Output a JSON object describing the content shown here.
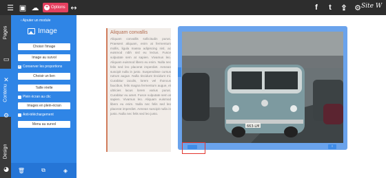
{
  "topbar": {
    "options_label": "Options",
    "logo_text": "Site W"
  },
  "tabs": {
    "pages": "Pages",
    "contenu": "Contenu",
    "design": "Design"
  },
  "panel": {
    "back_label": "Ajouter un module",
    "title": "Image",
    "btn_choose": "Choisir l'image",
    "btn_hover": "Image au survol",
    "chk_proportions": "Conserver les proportions",
    "btn_link": "Choisir un lien",
    "btn_size": "Taille réelle",
    "chk_fullscreen_click": "Plein écran au clic",
    "btn_fullscreen": "Images en plein-écran",
    "chk_antidownload": "Anti-téléchargement",
    "btn_hover_menu": "Menu au survol"
  },
  "text_module": {
    "title": "Aliquam convallis",
    "body": "Aliquam convallis sollicitudin purus. Praesent aliquam, enim at fermentum mollis, ligula massa adipiscing nisl, ac euismod nibh nisl eu lectus. Fusce vulputate sem at sapien. Vivamus leo. Aliquam euismod libero eu enim. Nulla nec felis sed leo placerat imperdiet. Aenean suscipit nulla in justo. Suspendisse cursus rutrum augue. Nulla tincidunt tincidunt mi. Curabitur iaculis, lorem vel rhoncus faucibus, felis magna fermentum augue, et ultricies lacus lorem varius purus. Curabitur eu amet. Fusce vulputate sem at sapien. Vivamus leo. Aliquam euismod libero eu enim. Nulla nec felis sed leo placerat imperdiet. Aenean suscipit nulla in justo. Nulla nec felis sed leo justo."
  },
  "photo": {
    "plate": "663-LM"
  },
  "colors": {
    "panel_blue": "#2f85e6",
    "options_red": "#e4405f",
    "highlight_red": "#e2332b"
  }
}
